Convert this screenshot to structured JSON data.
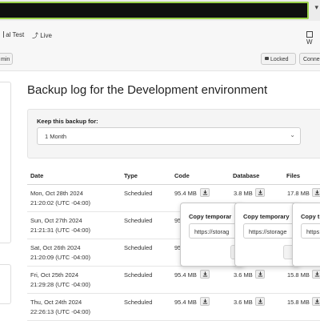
{
  "nav": {
    "tabs": [
      {
        "label": "al Test",
        "icon": "grid-icon"
      },
      {
        "label": "Live",
        "icon": "lightning-icon"
      },
      {
        "label": "W",
        "icon": "dashboard-icon"
      }
    ]
  },
  "toolbar": {
    "left_button": "min",
    "locked_button": "Locked",
    "connect_button": "Conne"
  },
  "page": {
    "title": "Backup log for the Development environment"
  },
  "keep": {
    "label": "Keep this backup for:",
    "selected": "1 Month"
  },
  "table": {
    "headers": [
      "Date",
      "Type",
      "Code",
      "Database",
      "Files"
    ],
    "rows": [
      {
        "date": "Mon, Oct 28th 2024",
        "time": "21:20:02 (UTC -04:00)",
        "type": "Scheduled",
        "code": "95.4 MB",
        "database": "3.8 MB",
        "files": "17.8 MB"
      },
      {
        "date": "Sun, Oct 27th 2024",
        "time": "21:21:31 (UTC -04:00)",
        "type": "Scheduled",
        "code": "95",
        "database": "",
        "files": ""
      },
      {
        "date": "Sat, Oct 26th 2024",
        "time": "21:20:09 (UTC -04:00)",
        "type": "Scheduled",
        "code": "95",
        "database": "",
        "files": ""
      },
      {
        "date": "Fri, Oct 25th 2024",
        "time": "21:29:28 (UTC -04:00)",
        "type": "Scheduled",
        "code": "95.4 MB",
        "database": "3.6 MB",
        "files": "15.8 MB"
      },
      {
        "date": "Thu, Oct 24th 2024",
        "time": "22:26:13 (UTC -04:00)",
        "type": "Scheduled",
        "code": "95.4 MB",
        "database": "3.6 MB",
        "files": "15.8 MB"
      }
    ]
  },
  "popovers": [
    {
      "title": "Copy temporar",
      "url": "https://storag"
    },
    {
      "title": "Copy temporary",
      "url": "https://storage"
    },
    {
      "title": "Copy t",
      "url": "https:/"
    }
  ]
}
